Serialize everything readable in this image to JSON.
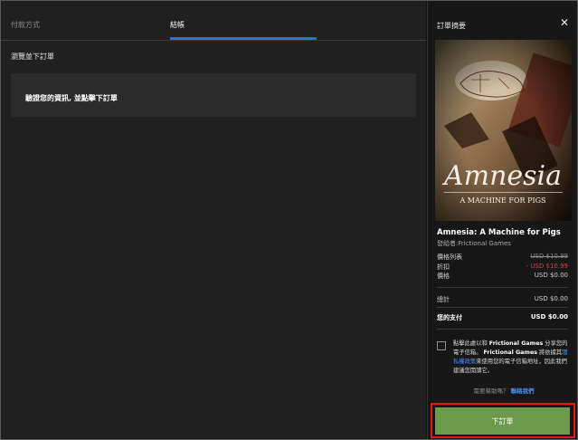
{
  "tabs": {
    "payment": "付款方式",
    "checkout": "結帳"
  },
  "left": {
    "heading": "瀏覽並下訂單",
    "info": "驗證您的資訊, 並點擊下訂單"
  },
  "summary": {
    "title": "訂單摘要",
    "game_title": "Amnesia: A Machine for Pigs",
    "publisher": "發給者:Frictional Games",
    "cover_title": "Amnesia",
    "cover_subtitle": "A MACHINE FOR PIGS",
    "price_rows": [
      {
        "label": "價格列表",
        "value": "USD $10.99"
      },
      {
        "label": "折扣",
        "value": "- USD $10.99"
      },
      {
        "label": "價格",
        "value": "USD $0.00"
      }
    ],
    "subtotal": {
      "label": "總計",
      "value": "USD $0.00"
    },
    "total": {
      "label": "您的支付",
      "value": "USD $0.00"
    }
  },
  "consent": {
    "part1": "點擊此處以和 ",
    "company1": "Frictional Games",
    "part2": " 分享您的電子信箱。 ",
    "company2": "Frictional Games",
    "part3": " 將依據其",
    "policy_link": "隱私權政策",
    "part4": "來使用您的電子信箱地址，因此我們建議您閱讀它。"
  },
  "help": {
    "text": "需要幫助嗎？",
    "link": "聯絡我們"
  },
  "order_button": "下訂單",
  "colors": {
    "accent_blue": "#2f6fd6",
    "order_green": "#6c9a4c",
    "highlight_red": "#e01818"
  }
}
